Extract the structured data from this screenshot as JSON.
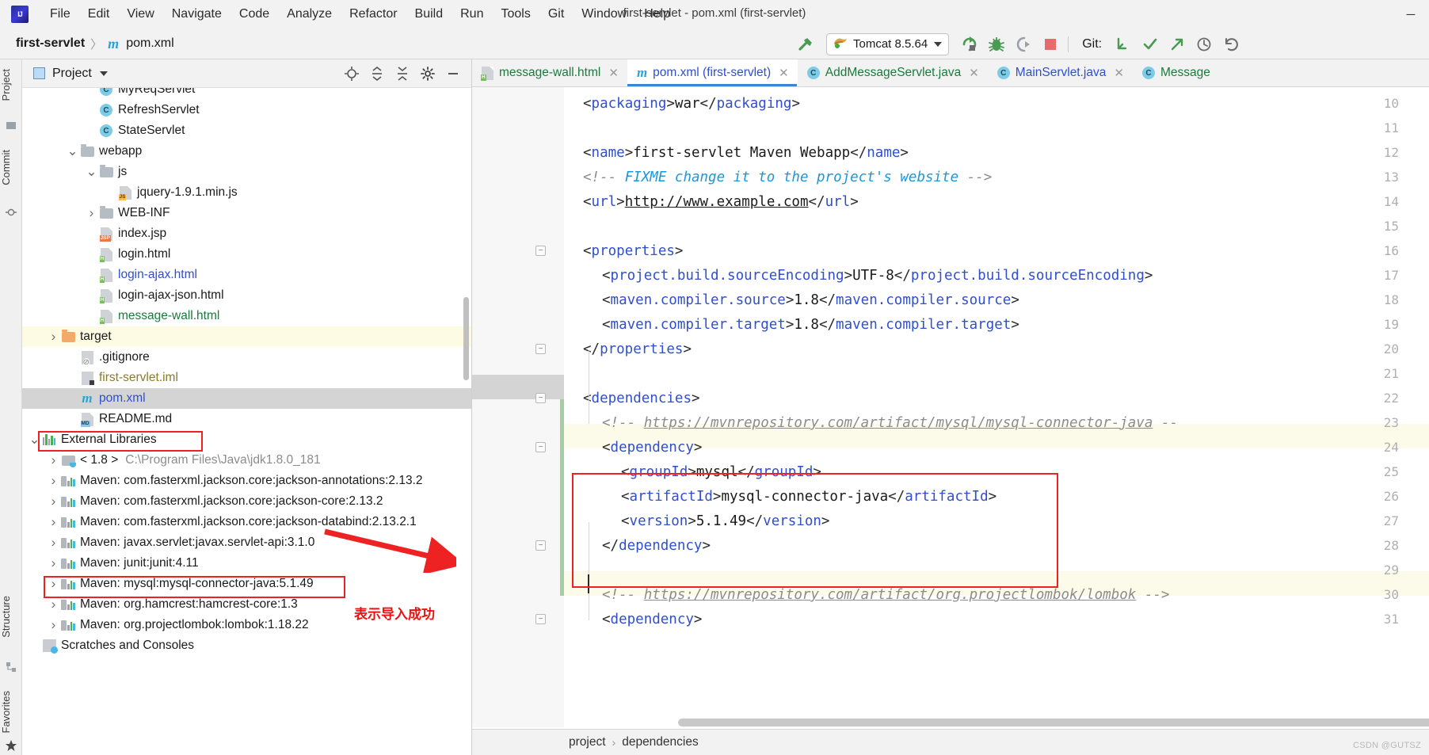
{
  "window": {
    "title": "first-servlet - pom.xml (first-servlet)",
    "minimize_label": "─",
    "maximize_label": "❐",
    "close_label": "✕"
  },
  "menubar": {
    "items": [
      {
        "label": "File"
      },
      {
        "label": "Edit"
      },
      {
        "label": "View"
      },
      {
        "label": "Navigate"
      },
      {
        "label": "Code"
      },
      {
        "label": "Analyze"
      },
      {
        "label": "Refactor"
      },
      {
        "label": "Build"
      },
      {
        "label": "Run"
      },
      {
        "label": "Tools"
      },
      {
        "label": "Git"
      },
      {
        "label": "Window"
      },
      {
        "label": "Help"
      }
    ]
  },
  "navbar": {
    "project_crumb": "first-servlet",
    "separator": "〉",
    "file_crumb": "pom.xml",
    "maven_icon": "m",
    "run_config": "Tomcat 8.5.64",
    "git_label": "Git:",
    "icons": {
      "build": "build-hammer-icon",
      "run": "run-icon",
      "debug": "debug-icon",
      "run_with_coverage": "run-with-coverage-icon",
      "stop": "stop-icon",
      "update_project": "git-update-icon",
      "commit": "git-commit-icon",
      "push": "git-push-icon",
      "history": "history-icon",
      "rollback": "rollback-icon"
    }
  },
  "left_stripe": {
    "top_items": [
      "Project",
      "Commit"
    ],
    "bottom_items": [
      "Structure",
      "Favorites"
    ]
  },
  "project_panel": {
    "title": "Project",
    "actions": [
      "locate-icon",
      "expand-all-icon",
      "collapse-all-icon",
      "settings-gear-icon",
      "hide-icon"
    ],
    "tree": [
      {
        "indent": 3,
        "arrow": "",
        "icon": "class",
        "label": "MyReqServlet",
        "color": "plain",
        "state": "partial"
      },
      {
        "indent": 3,
        "arrow": "",
        "icon": "class",
        "label": "RefreshServlet",
        "color": "plain"
      },
      {
        "indent": 3,
        "arrow": "",
        "icon": "class",
        "label": "StateServlet",
        "color": "plain"
      },
      {
        "indent": 2,
        "arrow": "expanded",
        "icon": "folder",
        "label": "webapp",
        "color": "plain"
      },
      {
        "indent": 3,
        "arrow": "expanded",
        "icon": "folder",
        "label": "js",
        "color": "plain"
      },
      {
        "indent": 4,
        "arrow": "",
        "icon": "js",
        "label": "jquery-1.9.1.min.js",
        "color": "plain"
      },
      {
        "indent": 3,
        "arrow": "collapsed",
        "icon": "folder",
        "label": "WEB-INF",
        "color": "plain"
      },
      {
        "indent": 3,
        "arrow": "",
        "icon": "jsp",
        "label": "index.jsp",
        "color": "plain"
      },
      {
        "indent": 3,
        "arrow": "",
        "icon": "html",
        "label": "login.html",
        "color": "plain"
      },
      {
        "indent": 3,
        "arrow": "",
        "icon": "html",
        "label": "login-ajax.html",
        "color": "blue"
      },
      {
        "indent": 3,
        "arrow": "",
        "icon": "html",
        "label": "login-ajax-json.html",
        "color": "plain"
      },
      {
        "indent": 3,
        "arrow": "",
        "icon": "html",
        "label": "message-wall.html",
        "color": "green"
      },
      {
        "indent": 1,
        "arrow": "collapsed",
        "icon": "folder-orange",
        "label": "target",
        "color": "plain",
        "highlight": "yellow"
      },
      {
        "indent": 2,
        "arrow": "",
        "icon": "gitignore",
        "label": ".gitignore",
        "color": "plain"
      },
      {
        "indent": 2,
        "arrow": "",
        "icon": "iml",
        "label": "first-servlet.iml",
        "color": "olive"
      },
      {
        "indent": 2,
        "arrow": "",
        "icon": "pom",
        "label": "pom.xml",
        "color": "blue",
        "selected": true
      },
      {
        "indent": 2,
        "arrow": "",
        "icon": "md",
        "label": "README.md",
        "color": "plain"
      },
      {
        "indent": 0,
        "arrow": "expanded",
        "icon": "ext-libs",
        "label": "External Libraries",
        "color": "plain",
        "boxed": true
      },
      {
        "indent": 1,
        "arrow": "collapsed",
        "icon": "jdk",
        "label": "< 1.8 >",
        "suffix": "C:\\Program Files\\Java\\jdk1.8.0_181",
        "color": "plain"
      },
      {
        "indent": 1,
        "arrow": "collapsed",
        "icon": "mvnlib",
        "label": "Maven: com.fasterxml.jackson.core:jackson-annotations:2.13.2",
        "color": "plain"
      },
      {
        "indent": 1,
        "arrow": "collapsed",
        "icon": "mvnlib",
        "label": "Maven: com.fasterxml.jackson.core:jackson-core:2.13.2",
        "color": "plain"
      },
      {
        "indent": 1,
        "arrow": "collapsed",
        "icon": "mvnlib",
        "label": "Maven: com.fasterxml.jackson.core:jackson-databind:2.13.2.1",
        "color": "plain"
      },
      {
        "indent": 1,
        "arrow": "collapsed",
        "icon": "mvnlib",
        "label": "Maven: javax.servlet:javax.servlet-api:3.1.0",
        "color": "plain"
      },
      {
        "indent": 1,
        "arrow": "collapsed",
        "icon": "mvnlib",
        "label": "Maven: junit:junit:4.11",
        "color": "plain"
      },
      {
        "indent": 1,
        "arrow": "collapsed",
        "icon": "mvnlib",
        "label": "Maven: mysql:mysql-connector-java:5.1.49",
        "color": "plain",
        "boxed": true
      },
      {
        "indent": 1,
        "arrow": "collapsed",
        "icon": "mvnlib",
        "label": "Maven: org.hamcrest:hamcrest-core:1.3",
        "color": "plain"
      },
      {
        "indent": 1,
        "arrow": "collapsed",
        "icon": "mvnlib",
        "label": "Maven: org.projectlombok:lombok:1.18.22",
        "color": "plain"
      },
      {
        "indent": 0,
        "arrow": "",
        "icon": "scratch",
        "label": "Scratches and Consoles",
        "color": "plain"
      }
    ]
  },
  "annotations": {
    "arrow_note": "表示导入成功",
    "accent_color": "#ee2222"
  },
  "editor": {
    "tabs": [
      {
        "label": "message-wall.html",
        "icon": "html-file-icon",
        "color": "green",
        "active": false,
        "close": "✕"
      },
      {
        "label": "pom.xml (first-servlet)",
        "icon": "maven-file-icon",
        "color": "blue",
        "active": true,
        "close": "✕"
      },
      {
        "label": "AddMessageServlet.java",
        "icon": "class-icon",
        "color": "green",
        "active": false,
        "close": "✕"
      },
      {
        "label": "MainServlet.java",
        "icon": "class-icon",
        "color": "blue",
        "active": false,
        "close": "✕"
      },
      {
        "label": "Message",
        "icon": "class-icon",
        "color": "green",
        "active": false,
        "close": ""
      }
    ],
    "line_numbers": [
      10,
      11,
      12,
      13,
      14,
      15,
      16,
      17,
      18,
      19,
      20,
      21,
      22,
      23,
      24,
      25,
      26,
      27,
      28,
      29,
      30,
      31
    ],
    "lines": [
      {
        "n": 10,
        "indent": 1,
        "segs": [
          {
            "t": "<",
            "c": "punct"
          },
          {
            "t": "packaging",
            "c": "tagname"
          },
          {
            "t": ">",
            "c": "punct"
          },
          {
            "t": "war",
            "c": "txtval"
          },
          {
            "t": "</",
            "c": "punct"
          },
          {
            "t": "packaging",
            "c": "tagname"
          },
          {
            "t": ">",
            "c": "punct"
          }
        ]
      },
      {
        "n": 11,
        "indent": 1,
        "segs": []
      },
      {
        "n": 12,
        "indent": 1,
        "segs": [
          {
            "t": "<",
            "c": "punct"
          },
          {
            "t": "name",
            "c": "tagname"
          },
          {
            "t": ">",
            "c": "punct"
          },
          {
            "t": "first-servlet Maven Webapp",
            "c": "txtval"
          },
          {
            "t": "</",
            "c": "punct"
          },
          {
            "t": "name",
            "c": "tagname"
          },
          {
            "t": ">",
            "c": "punct"
          }
        ]
      },
      {
        "n": 13,
        "indent": 1,
        "segs": [
          {
            "t": "<!-- ",
            "c": "comment"
          },
          {
            "t": "FIXME change it to the project's website",
            "c": "comment-fixme"
          },
          {
            "t": " -->",
            "c": "comment"
          }
        ]
      },
      {
        "n": 14,
        "indent": 1,
        "segs": [
          {
            "t": "<",
            "c": "punct"
          },
          {
            "t": "url",
            "c": "tagname"
          },
          {
            "t": ">",
            "c": "punct"
          },
          {
            "t": "http://www.example.com",
            "c": "ulink"
          },
          {
            "t": "</",
            "c": "punct"
          },
          {
            "t": "url",
            "c": "tagname"
          },
          {
            "t": ">",
            "c": "punct"
          }
        ]
      },
      {
        "n": 15,
        "indent": 1,
        "segs": []
      },
      {
        "n": 16,
        "indent": 1,
        "segs": [
          {
            "t": "<",
            "c": "punct"
          },
          {
            "t": "properties",
            "c": "tagname"
          },
          {
            "t": ">",
            "c": "punct"
          }
        ]
      },
      {
        "n": 17,
        "indent": 2,
        "segs": [
          {
            "t": "<",
            "c": "punct"
          },
          {
            "t": "project.build.sourceEncoding",
            "c": "tagname"
          },
          {
            "t": ">",
            "c": "punct"
          },
          {
            "t": "UTF-8",
            "c": "txtval"
          },
          {
            "t": "</",
            "c": "punct"
          },
          {
            "t": "project.build.sourceEncoding",
            "c": "tagname"
          },
          {
            "t": ">",
            "c": "punct"
          }
        ]
      },
      {
        "n": 18,
        "indent": 2,
        "segs": [
          {
            "t": "<",
            "c": "punct"
          },
          {
            "t": "maven.compiler.source",
            "c": "tagname"
          },
          {
            "t": ">",
            "c": "punct"
          },
          {
            "t": "1.8",
            "c": "txtval"
          },
          {
            "t": "</",
            "c": "punct"
          },
          {
            "t": "maven.compiler.source",
            "c": "tagname"
          },
          {
            "t": ">",
            "c": "punct"
          }
        ]
      },
      {
        "n": 19,
        "indent": 2,
        "segs": [
          {
            "t": "<",
            "c": "punct"
          },
          {
            "t": "maven.compiler.target",
            "c": "tagname"
          },
          {
            "t": ">",
            "c": "punct"
          },
          {
            "t": "1.8",
            "c": "txtval"
          },
          {
            "t": "</",
            "c": "punct"
          },
          {
            "t": "maven.compiler.target",
            "c": "tagname"
          },
          {
            "t": ">",
            "c": "punct"
          }
        ]
      },
      {
        "n": 20,
        "indent": 1,
        "segs": [
          {
            "t": "</",
            "c": "punct"
          },
          {
            "t": "properties",
            "c": "tagname"
          },
          {
            "t": ">",
            "c": "punct"
          }
        ]
      },
      {
        "n": 21,
        "indent": 1,
        "segs": []
      },
      {
        "n": 22,
        "indent": 1,
        "segs": [
          {
            "t": "<",
            "c": "punct"
          },
          {
            "t": "dependencies",
            "c": "tagname"
          },
          {
            "t": ">",
            "c": "punct"
          }
        ]
      },
      {
        "n": 23,
        "indent": 2,
        "segs": [
          {
            "t": "<!-- ",
            "c": "comment"
          },
          {
            "t": "https://mvnrepository.com/artifact/mysql/mysql-connector-java",
            "c": "clink"
          },
          {
            "t": " --",
            "c": "comment"
          }
        ]
      },
      {
        "n": 24,
        "indent": 2,
        "segs": [
          {
            "t": "<",
            "c": "punct"
          },
          {
            "t": "dependency",
            "c": "tagname"
          },
          {
            "t": ">",
            "c": "punct"
          }
        ]
      },
      {
        "n": 25,
        "indent": 3,
        "segs": [
          {
            "t": "<",
            "c": "punct"
          },
          {
            "t": "groupId",
            "c": "tagname"
          },
          {
            "t": ">",
            "c": "punct"
          },
          {
            "t": "mysql",
            "c": "txtval"
          },
          {
            "t": "</",
            "c": "punct"
          },
          {
            "t": "groupId",
            "c": "tagname"
          },
          {
            "t": ">",
            "c": "punct"
          }
        ]
      },
      {
        "n": 26,
        "indent": 3,
        "segs": [
          {
            "t": "<",
            "c": "punct"
          },
          {
            "t": "artifactId",
            "c": "tagname"
          },
          {
            "t": ">",
            "c": "punct"
          },
          {
            "t": "mysql-connector-java",
            "c": "txtval"
          },
          {
            "t": "</",
            "c": "punct"
          },
          {
            "t": "artifactId",
            "c": "tagname"
          },
          {
            "t": ">",
            "c": "punct"
          }
        ]
      },
      {
        "n": 27,
        "indent": 3,
        "segs": [
          {
            "t": "<",
            "c": "punct"
          },
          {
            "t": "version",
            "c": "tagname"
          },
          {
            "t": ">",
            "c": "punct"
          },
          {
            "t": "5.1.49",
            "c": "txtval"
          },
          {
            "t": "</",
            "c": "punct"
          },
          {
            "t": "version",
            "c": "tagname"
          },
          {
            "t": ">",
            "c": "punct"
          }
        ]
      },
      {
        "n": 28,
        "indent": 2,
        "segs": [
          {
            "t": "</",
            "c": "punct"
          },
          {
            "t": "dependency",
            "c": "tagname"
          },
          {
            "t": ">",
            "c": "punct"
          }
        ]
      },
      {
        "n": 29,
        "indent": 2,
        "segs": []
      },
      {
        "n": 30,
        "indent": 2,
        "segs": [
          {
            "t": "<!-- ",
            "c": "comment"
          },
          {
            "t": "https://mvnrepository.com/artifact/org.projectlombok/lombok",
            "c": "clink"
          },
          {
            "t": " -->",
            "c": "comment"
          }
        ]
      },
      {
        "n": 31,
        "indent": 2,
        "segs": [
          {
            "t": "<",
            "c": "punct"
          },
          {
            "t": "dependency",
            "c": "tagname"
          },
          {
            "t": ">",
            "c": "punct"
          }
        ]
      }
    ],
    "caret_line": 29,
    "breadcrumb": {
      "root": "project",
      "sep": "›",
      "leaf": "dependencies"
    },
    "watermark": "CSDN @GUTSZ"
  }
}
